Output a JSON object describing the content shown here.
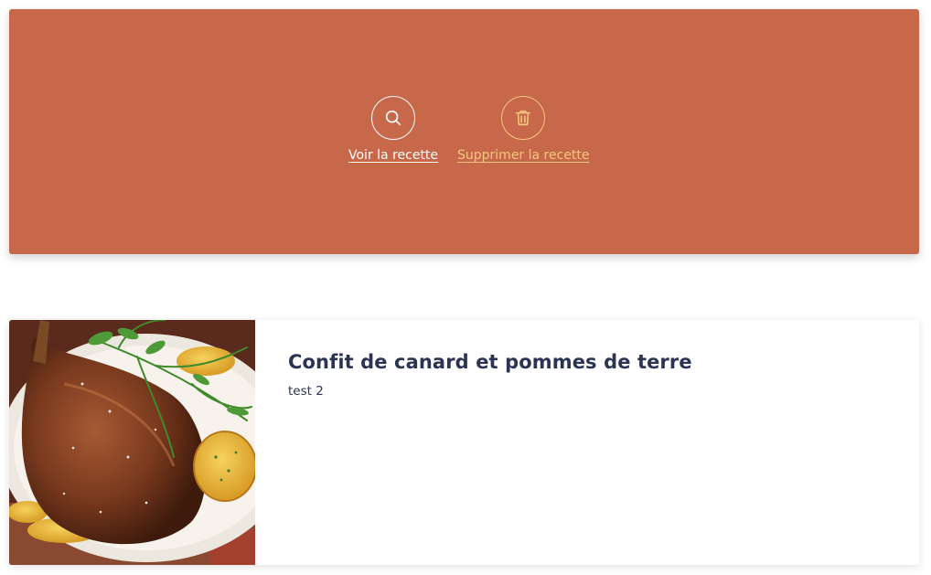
{
  "colors": {
    "overlay_bg": "#c7684b",
    "view_link": "#ffffff",
    "delete_link": "#f6c77d",
    "title_text": "#2b3452",
    "desc_text": "#2b3452"
  },
  "overlay": {
    "view_action": {
      "icon": "search-icon",
      "label": "Voir la recette"
    },
    "delete_action": {
      "icon": "trash-icon",
      "label": "Supprimer la recette"
    }
  },
  "recipe": {
    "image_subject": "photo of duck confit with potatoes and herbs",
    "title": "Confit de canard et pommes de terre",
    "description": "test 2"
  }
}
